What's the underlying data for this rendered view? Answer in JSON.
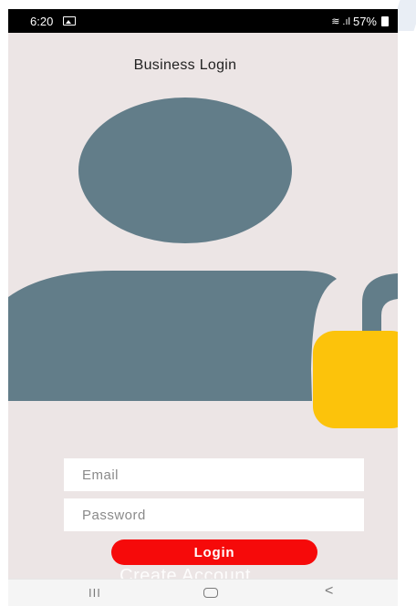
{
  "statusbar": {
    "time": "6:20",
    "battery": "57%"
  },
  "page": {
    "title": "Business Login"
  },
  "form": {
    "email_placeholder": "Email",
    "password_placeholder": "Password",
    "login_label": "Login",
    "create_account_label": "Create Account"
  },
  "colors": {
    "background": "#ece5e5",
    "person": "#627d89",
    "lock": "#fcc30b",
    "login_button": "#f60a0a"
  },
  "icons": [
    "gallery-icon",
    "wifi-icon",
    "signal-icon",
    "battery-icon",
    "recent-apps-icon",
    "home-icon",
    "back-icon"
  ]
}
